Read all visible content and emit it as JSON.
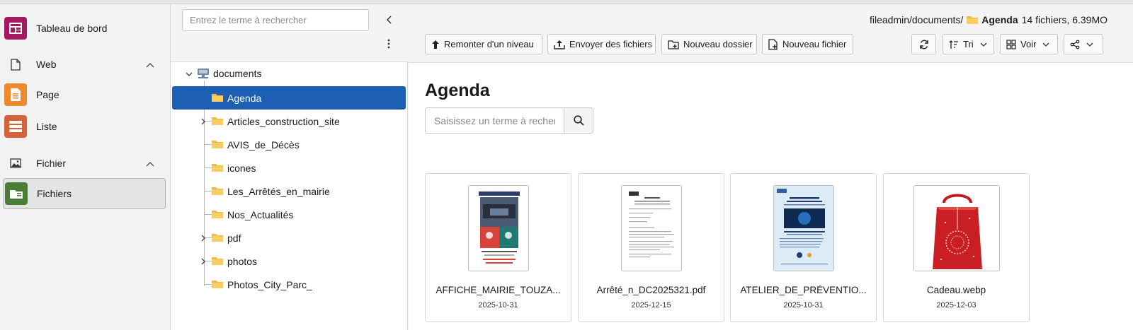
{
  "modules": {
    "dashboard": "Tableau de bord",
    "web_group": "Web",
    "page": "Page",
    "list": "Liste",
    "file_group": "Fichier",
    "files": "Fichiers"
  },
  "tree": {
    "search_placeholder": "Entrez le terme à rechercher",
    "root": "documents",
    "nodes": [
      {
        "label": "Agenda"
      },
      {
        "label": "Articles_construction_site"
      },
      {
        "label": "AVIS_de_Décès"
      },
      {
        "label": "icones"
      },
      {
        "label": "Les_Arrêtés_en_mairie"
      },
      {
        "label": "Nos_Actualités"
      },
      {
        "label": "pdf"
      },
      {
        "label": "photos"
      },
      {
        "label": "Photos_City_Parc_"
      }
    ]
  },
  "header": {
    "path": "fileadmin/documents/",
    "current": "Agenda",
    "info": "14 fichiers, 6.39MO"
  },
  "toolbar": {
    "up": "Remonter d'un niveau",
    "upload": "Envoyer des fichiers",
    "new_folder": "Nouveau dossier",
    "new_file": "Nouveau fichier",
    "sort": "Tri",
    "view": "Voir"
  },
  "main": {
    "title": "Agenda",
    "search_placeholder": "Saisissez un terme à rechercher"
  },
  "files": [
    {
      "name": "AFFICHE_MAIRIE_TOUZA...",
      "date": "2025-10-31"
    },
    {
      "name": "Arrêté_n_DC2025321.pdf",
      "date": "2025-12-15"
    },
    {
      "name": "ATELIER_DE_PRÉVENTIO...",
      "date": "2025-10-31"
    },
    {
      "name": "Cadeau.webp",
      "date": "2025-12-03"
    }
  ],
  "colors": {
    "selected": "#1d5fb3",
    "folder": "#f5b93b",
    "dashboard_icon": "#a51a5c",
    "page_icon": "#ee8a2d",
    "list_icon": "#d6623a",
    "files_icon": "#4a7e37"
  }
}
